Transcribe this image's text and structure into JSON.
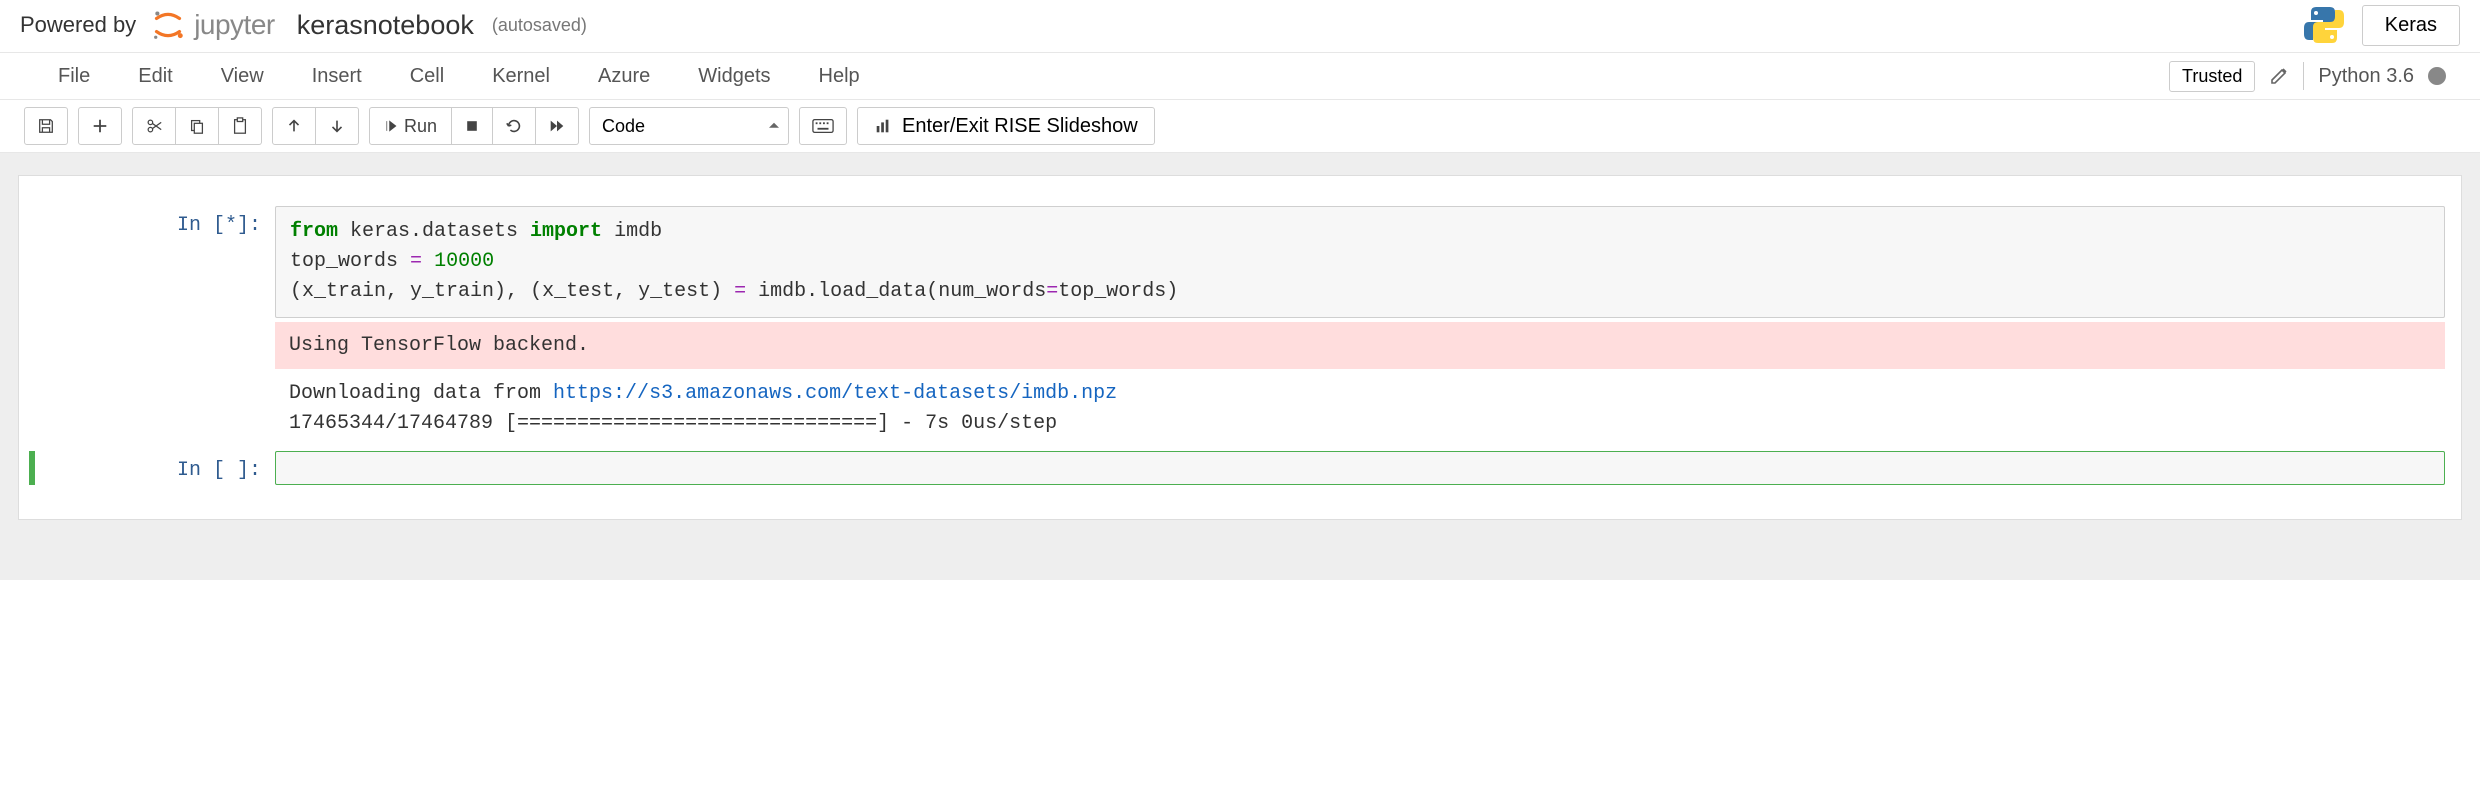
{
  "header": {
    "powered_by": "Powered by",
    "jupyter_word": "jupyter",
    "notebook_title": "kerasnotebook",
    "autosaved": "(autosaved)",
    "keras_button": "Keras"
  },
  "menubar": {
    "items": [
      "File",
      "Edit",
      "View",
      "Insert",
      "Cell",
      "Kernel",
      "Azure",
      "Widgets",
      "Help"
    ],
    "trusted": "Trusted",
    "kernel_name": "Python 3.6"
  },
  "toolbar": {
    "run_label": "Run",
    "celltype_selected": "Code",
    "rise_label": "Enter/Exit RISE Slideshow"
  },
  "cells": [
    {
      "prompt": "In [*]:",
      "code_tokens": [
        {
          "t": "from",
          "c": "kw"
        },
        {
          "t": " keras.datasets "
        },
        {
          "t": "import",
          "c": "kw"
        },
        {
          "t": " imdb\n"
        },
        {
          "t": "top_words "
        },
        {
          "t": "=",
          "c": "op"
        },
        {
          "t": " "
        },
        {
          "t": "10000",
          "c": "num"
        },
        {
          "t": "\n"
        },
        {
          "t": "(",
          "c": "paren"
        },
        {
          "t": "x_train, y_train"
        },
        {
          "t": ")",
          "c": "paren"
        },
        {
          "t": ", "
        },
        {
          "t": "(",
          "c": "paren"
        },
        {
          "t": "x_test, y_test"
        },
        {
          "t": ")",
          "c": "paren"
        },
        {
          "t": " "
        },
        {
          "t": "=",
          "c": "op"
        },
        {
          "t": " imdb.load_data"
        },
        {
          "t": "(",
          "c": "paren"
        },
        {
          "t": "num_words"
        },
        {
          "t": "=",
          "c": "op"
        },
        {
          "t": "top_words"
        },
        {
          "t": ")",
          "c": "paren"
        }
      ],
      "stderr": "Using TensorFlow backend.",
      "stdout_prefix": "Downloading data from ",
      "stdout_link": "https://s3.amazonaws.com/text-datasets/imdb.npz",
      "stdout_line2": "17465344/17464789 [==============================] - 7s 0us/step"
    },
    {
      "prompt": "In [ ]:",
      "code_tokens": []
    }
  ]
}
